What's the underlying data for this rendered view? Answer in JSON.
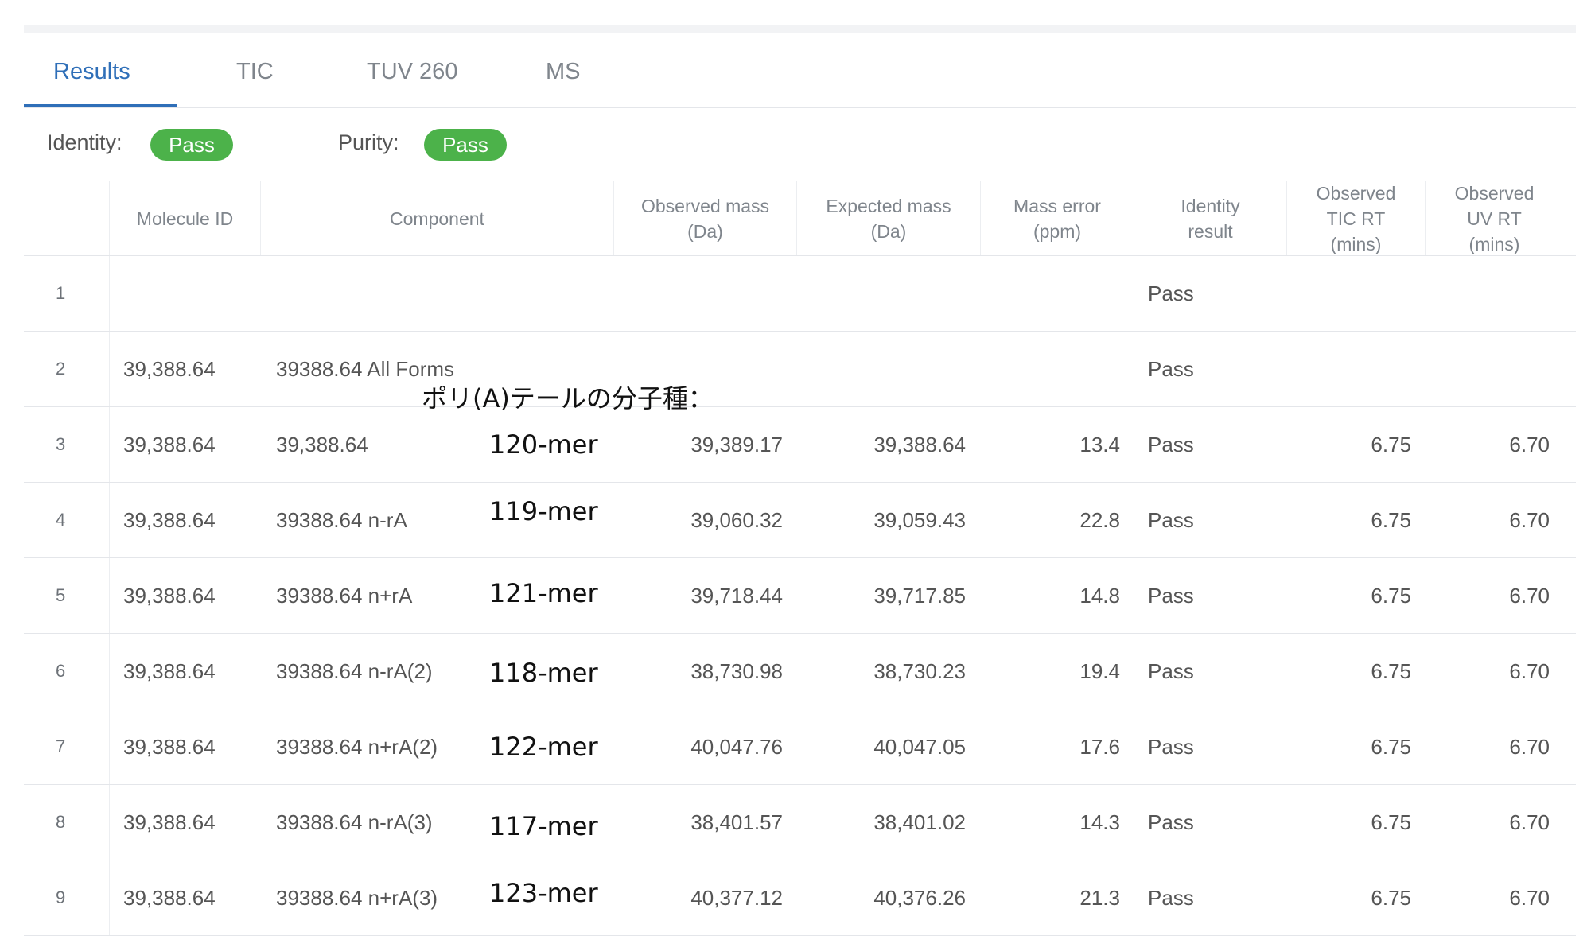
{
  "tabs": [
    {
      "label": "Results",
      "active": true
    },
    {
      "label": "TIC",
      "active": false
    },
    {
      "label": "TUV 260",
      "active": false
    },
    {
      "label": "MS",
      "active": false
    }
  ],
  "summary": {
    "identity_label": "Identity:",
    "identity_status": "Pass",
    "purity_label": "Purity:",
    "purity_status": "Pass"
  },
  "table": {
    "headers": [
      "",
      "Molecule ID",
      "Component",
      "Observed mass (Da)",
      "Expected mass (Da)",
      "Mass error (ppm)",
      "Identity result",
      "Observed TIC RT (mins)",
      "Observed UV RT (mins)"
    ],
    "rows": [
      {
        "index": "1",
        "molecule_id": "",
        "component": "",
        "observed_mass": "",
        "expected_mass": "",
        "mass_error": "",
        "identity": "Pass",
        "tic_rt": "",
        "uv_rt": ""
      },
      {
        "index": "2",
        "molecule_id": "39,388.64",
        "component": "39388.64 All Forms",
        "observed_mass": "",
        "expected_mass": "",
        "mass_error": "",
        "identity": "Pass",
        "tic_rt": "",
        "uv_rt": ""
      },
      {
        "index": "3",
        "molecule_id": "39,388.64",
        "component": "39,388.64",
        "observed_mass": "39,389.17",
        "expected_mass": "39,388.64",
        "mass_error": "13.4",
        "identity": "Pass",
        "tic_rt": "6.75",
        "uv_rt": "6.70"
      },
      {
        "index": "4",
        "molecule_id": "39,388.64",
        "component": "39388.64 n-rA",
        "observed_mass": "39,060.32",
        "expected_mass": "39,059.43",
        "mass_error": "22.8",
        "identity": "Pass",
        "tic_rt": "6.75",
        "uv_rt": "6.70"
      },
      {
        "index": "5",
        "molecule_id": "39,388.64",
        "component": "39388.64 n+rA",
        "observed_mass": "39,718.44",
        "expected_mass": "39,717.85",
        "mass_error": "14.8",
        "identity": "Pass",
        "tic_rt": "6.75",
        "uv_rt": "6.70"
      },
      {
        "index": "6",
        "molecule_id": "39,388.64",
        "component": "39388.64 n-rA(2)",
        "observed_mass": "38,730.98",
        "expected_mass": "38,730.23",
        "mass_error": "19.4",
        "identity": "Pass",
        "tic_rt": "6.75",
        "uv_rt": "6.70"
      },
      {
        "index": "7",
        "molecule_id": "39,388.64",
        "component": "39388.64 n+rA(2)",
        "observed_mass": "40,047.76",
        "expected_mass": "40,047.05",
        "mass_error": "17.6",
        "identity": "Pass",
        "tic_rt": "6.75",
        "uv_rt": "6.70"
      },
      {
        "index": "8",
        "molecule_id": "39,388.64",
        "component": "39388.64 n-rA(3)",
        "observed_mass": "38,401.57",
        "expected_mass": "38,401.02",
        "mass_error": "14.3",
        "identity": "Pass",
        "tic_rt": "6.75",
        "uv_rt": "6.70"
      },
      {
        "index": "9",
        "molecule_id": "39,388.64",
        "component": "39388.64 n+rA(3)",
        "observed_mass": "40,377.12",
        "expected_mass": "40,376.26",
        "mass_error": "21.3",
        "identity": "Pass",
        "tic_rt": "6.75",
        "uv_rt": "6.70"
      }
    ]
  },
  "annotations": {
    "caption": "ポリ(A)テールの分子種：",
    "mers": [
      "120-mer",
      "119-mer",
      "121-mer",
      "118-mer",
      "122-mer",
      "117-mer",
      "123-mer"
    ]
  },
  "colors": {
    "accent": "#2f6fb8",
    "pass_badge": "#4cb24a",
    "divider": "#e4e6ea"
  }
}
